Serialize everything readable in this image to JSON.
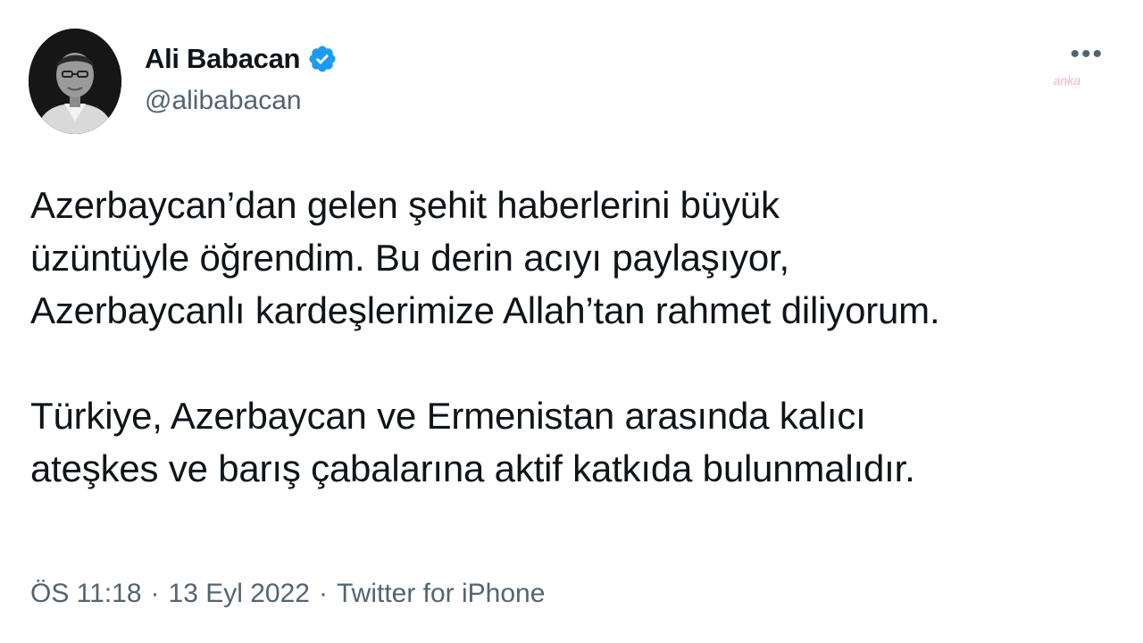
{
  "author": {
    "display_name": "Ali Babacan",
    "handle": "@alibabacan",
    "verified": true,
    "avatar_icon": "profile-photo"
  },
  "header": {
    "more_label": "•••",
    "more_icon": "more-options-icon",
    "watermark": "anka"
  },
  "tweet": {
    "paragraph_1": "Azerbaycan’dan gelen şehit haberlerini büyük\nüzüntüyle öğrendim. Bu derin acıyı paylaşıyor,\nAzerbaycanlı kardeşlerimize Allah’tan rahmet diliyorum.",
    "paragraph_2": "Türkiye, Azerbaycan ve Ermenistan arasında kalıcı\nateşkes ve barış çabalarına aktif katkıda bulunmalıdır."
  },
  "meta": {
    "time": "ÖS 11:18",
    "date": "13 Eyl 2022",
    "source": "Twitter for iPhone",
    "separator": "·"
  },
  "colors": {
    "text_primary": "#0f1419",
    "text_secondary": "#536471",
    "verified_blue": "#1d9bf0"
  }
}
